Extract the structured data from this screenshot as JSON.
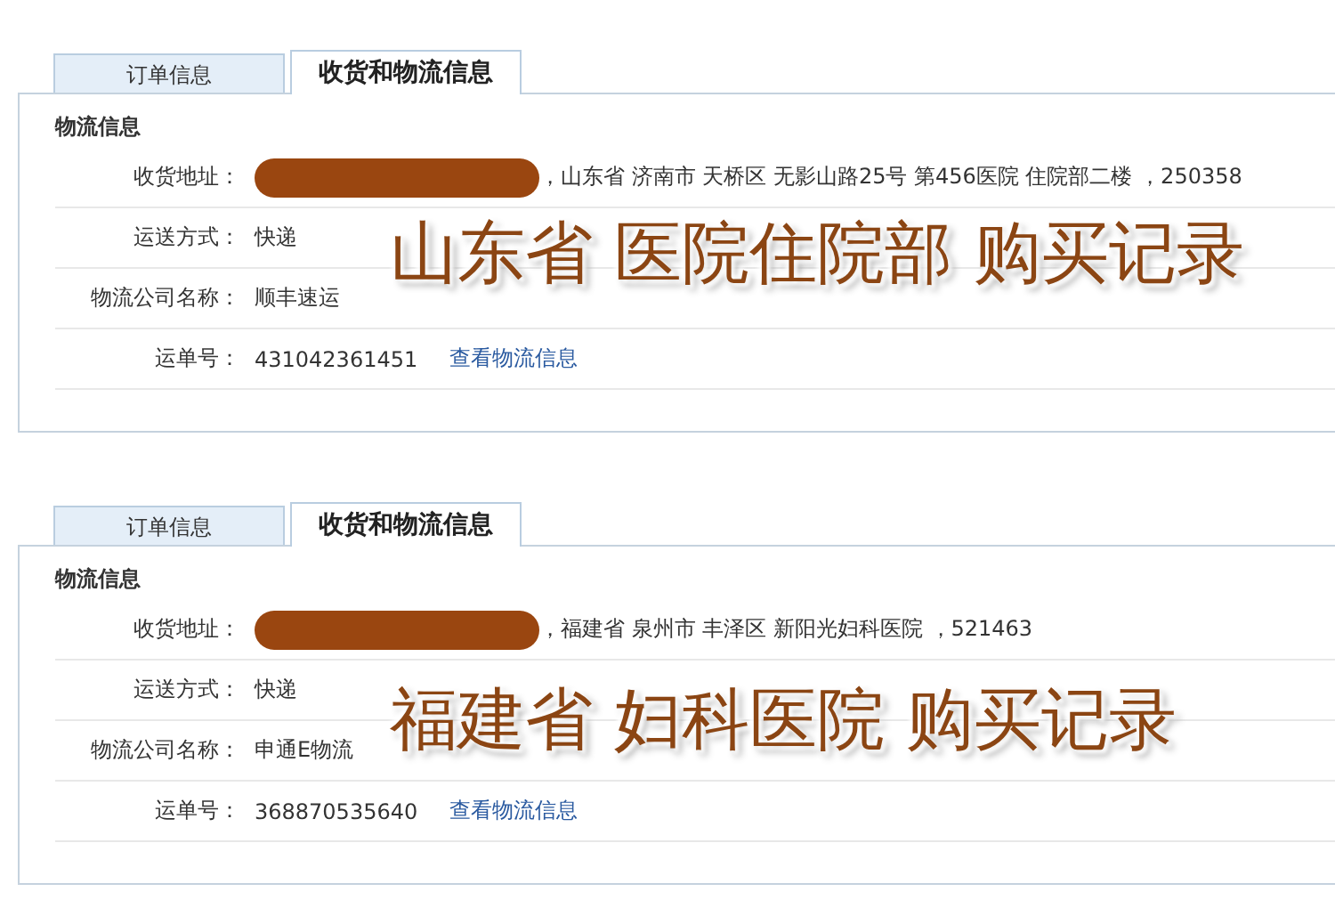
{
  "panels": [
    {
      "tabs": [
        {
          "label": "订单信息",
          "selected": false
        },
        {
          "label": "收货和物流信息",
          "selected": true
        }
      ],
      "section_title": "物流信息",
      "rows": [
        {
          "kind": "address",
          "label": "收货地址：",
          "redacted": true,
          "value": "，山东省  济南市  天桥区  无影山路25号  第456医院  住院部二楼  ，250358"
        },
        {
          "kind": "text",
          "label": "运送方式：",
          "value": "快递"
        },
        {
          "kind": "text",
          "label": "物流公司名称：",
          "value": "顺丰速运"
        },
        {
          "kind": "tracking",
          "label": "运单号：",
          "value": "431042361451",
          "link": "查看物流信息"
        }
      ],
      "caption": "山东省 医院住院部 购买记录"
    },
    {
      "tabs": [
        {
          "label": "订单信息",
          "selected": false
        },
        {
          "label": "收货和物流信息",
          "selected": true
        }
      ],
      "section_title": "物流信息",
      "rows": [
        {
          "kind": "address",
          "label": "收货地址：",
          "redacted": true,
          "value": "，福建省  泉州市  丰泽区  新阳光妇科医院  ，521463"
        },
        {
          "kind": "text",
          "label": "运送方式：",
          "value": "快递"
        },
        {
          "kind": "text",
          "label": "物流公司名称：",
          "value": "申通E物流"
        },
        {
          "kind": "tracking",
          "label": "运单号：",
          "value": "368870535640",
          "link": "查看物流信息"
        }
      ],
      "caption": "福建省 妇科医院 购买记录"
    }
  ]
}
